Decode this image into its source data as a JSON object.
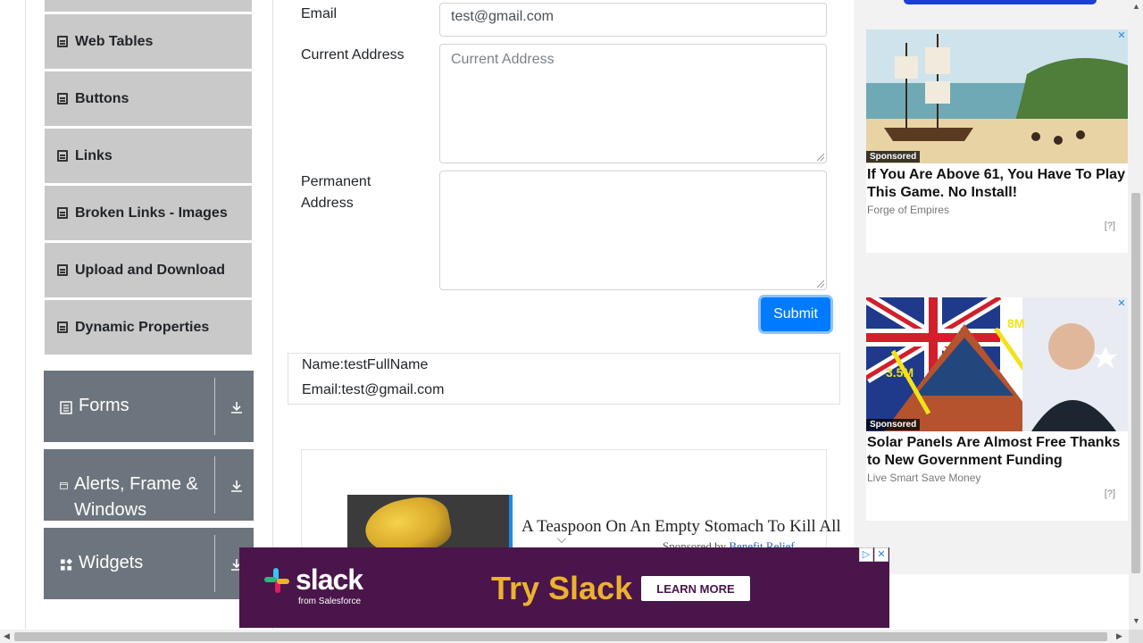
{
  "sidebar": {
    "items": [
      {
        "label": "Web Tables"
      },
      {
        "label": "Buttons"
      },
      {
        "label": "Links"
      },
      {
        "label": "Broken Links - Images"
      },
      {
        "label": "Upload and Download"
      },
      {
        "label": "Dynamic Properties"
      }
    ],
    "groups": [
      {
        "label": "Forms",
        "icon": "form-icon"
      },
      {
        "label": "Alerts, Frame & Windows",
        "icon": "window-icon"
      },
      {
        "label": "Widgets",
        "icon": "widgets-icon"
      }
    ]
  },
  "form": {
    "email_label": "Email",
    "email_value": "test@gmail.com",
    "current_address_label": "Current Address",
    "current_address_placeholder": "Current Address",
    "permanent_address_label": "Permanent Address",
    "submit_label": "Submit"
  },
  "output": {
    "name": "Name:testFullName",
    "email": "Email:test@gmail.com"
  },
  "inline_ad": {
    "headline": "A Teaspoon On An Empty Stomach To Kill All",
    "sub_prefix": "Sponsored by",
    "sub_brand": "Benefit Relief"
  },
  "right_ads": [
    {
      "sponsored": "Sponsored",
      "title": "If You Are Above 61, You Have To Play This Game. No Install!",
      "source": "Forge of Empires",
      "help": "[?]"
    },
    {
      "sponsored": "Sponsored",
      "title": "Solar Panels Are Almost Free Thanks to New Government Funding",
      "source": "Live Smart Save Money",
      "help": "[?]",
      "overlay_a": "8M",
      "overlay_b": "3.5M"
    }
  ],
  "slack_banner": {
    "logo_text": "slack",
    "from_text": "from Salesforce",
    "headline": "Try Slack",
    "cta": "LEARN MORE"
  },
  "colors": {
    "sidebar_item_bg": "#c9c9c9",
    "group_bg": "#6c757d",
    "submit_bg": "#007bff",
    "slack_bg": "#4a154b",
    "slack_yellow": "#ecb22e"
  }
}
